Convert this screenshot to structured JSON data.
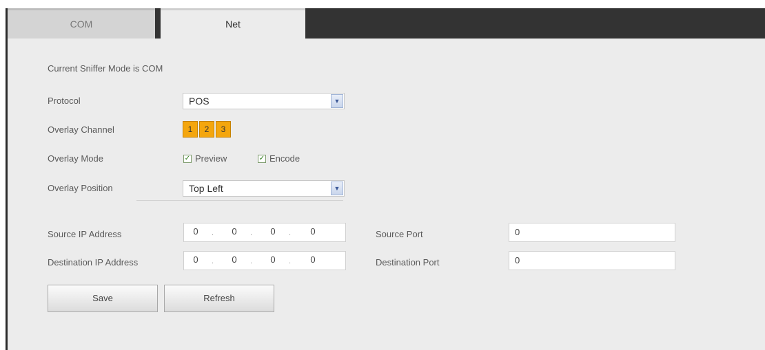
{
  "tabs": [
    {
      "label": "COM"
    },
    {
      "label": "Net"
    }
  ],
  "sniffer_mode_text": "Current Sniffer Mode is COM",
  "protocol": {
    "label": "Protocol",
    "value": "POS"
  },
  "overlay_channel": {
    "label": "Overlay Channel",
    "channels": [
      "1",
      "2",
      "3"
    ]
  },
  "overlay_mode": {
    "label": "Overlay Mode",
    "preview": {
      "label": "Preview",
      "checked": true
    },
    "encode": {
      "label": "Encode",
      "checked": true
    }
  },
  "overlay_position": {
    "label": "Overlay Position",
    "value": "Top Left"
  },
  "source_ip": {
    "label": "Source IP Address",
    "octets": [
      "0",
      "0",
      "0",
      "0"
    ]
  },
  "destination_ip": {
    "label": "Destination IP Address",
    "octets": [
      "0",
      "0",
      "0",
      "0"
    ]
  },
  "source_port": {
    "label": "Source Port",
    "value": "0"
  },
  "destination_port": {
    "label": "Destination Port",
    "value": "0"
  },
  "buttons": {
    "save": "Save",
    "refresh": "Refresh"
  },
  "colors": {
    "tab_bar": "#333333",
    "panel": "#ececec",
    "channel_button": "#f4a60e"
  }
}
